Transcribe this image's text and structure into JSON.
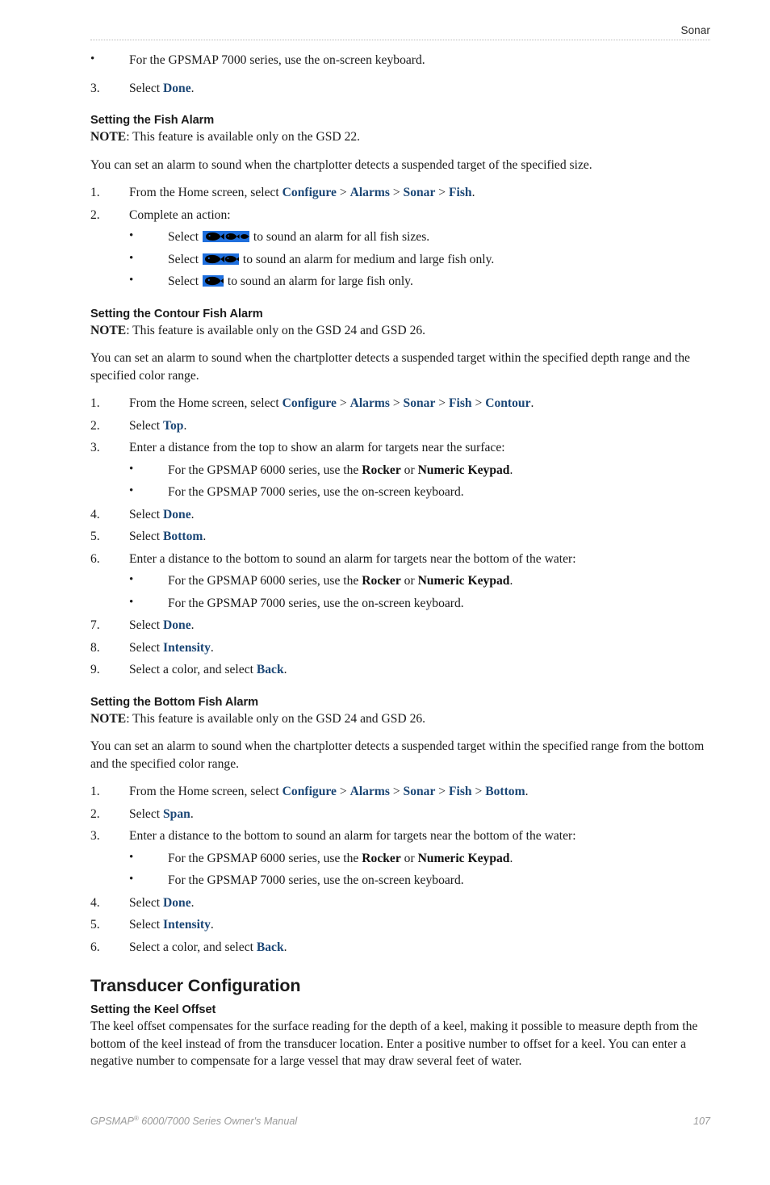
{
  "header": {
    "running_title": "Sonar"
  },
  "footer": {
    "manual_title_pre": "GPSMAP",
    "manual_title_sup": "®",
    "manual_title_post": " 6000/7000 Series Owner's Manual",
    "page_number": "107"
  },
  "colors": {
    "nav_link": "#1c4776",
    "fish_icon_background": "#1f6fdd",
    "fish_body": "#000000",
    "header_rule": "#b9b9b9",
    "footer_text": "#9a9a9a"
  },
  "carryover": {
    "bullet": "For the GPSMAP 7000 series, use the on-screen keyboard.",
    "step3_pre": "Select ",
    "step3_num": "3.",
    "step3_nav": "Done",
    "step3_post": "."
  },
  "sections": [
    {
      "id": "fish-alarm",
      "heading": "Setting the Fish Alarm",
      "note_label": "NOTE",
      "note_text": ": This feature is available only on the GSD 22.",
      "intro": "You can set an alarm to sound when the chartplotter detects a suspended target of the specified size.",
      "step1_num": "1.",
      "step1_pre": "From the Home screen, select ",
      "step1_path": [
        "Configure",
        "Alarms",
        "Sonar",
        "Fish"
      ],
      "step1_post": ".",
      "step2_num": "2.",
      "step2_text": "Complete an action:",
      "icon_bullets": [
        {
          "pre": "Select ",
          "icon": "fish-icon-three",
          "fish_count": 3,
          "post": " to sound an alarm for all fish sizes."
        },
        {
          "pre": "Select ",
          "icon": "fish-icon-two",
          "fish_count": 2,
          "post": " to sound an alarm for medium and large fish only."
        },
        {
          "pre": "Select ",
          "icon": "fish-icon-one",
          "fish_count": 1,
          "post": " to sound an alarm for large fish only."
        }
      ]
    },
    {
      "id": "contour-fish-alarm",
      "heading": "Setting the Contour Fish Alarm",
      "note_label": "NOTE",
      "note_text": ": This feature is available only on the GSD 24 and GSD 26.",
      "intro": "You can set an alarm to sound when the chartplotter detects a suspended target within the specified depth range and the specified color range.",
      "steps": [
        {
          "num": "1.",
          "pre": "From the Home screen, select ",
          "path": [
            "Configure",
            "Alarms",
            "Sonar",
            "Fish",
            "Contour"
          ],
          "post": "."
        },
        {
          "num": "2.",
          "pre": "Select ",
          "nav": "Top",
          "post": "."
        },
        {
          "num": "3.",
          "plain": "Enter a distance from the top to show an alarm for targets near the surface:",
          "bullets": [
            {
              "pre": "For the GPSMAP 6000 series, use the ",
              "b1": "Rocker",
              "mid": " or ",
              "b2": "Numeric Keypad",
              "post": "."
            },
            {
              "plain": "For the GPSMAP 7000 series, use the on-screen keyboard."
            }
          ]
        },
        {
          "num": "4.",
          "pre": "Select ",
          "nav": "Done",
          "post": "."
        },
        {
          "num": "5.",
          "pre": "Select ",
          "nav": "Bottom",
          "post": "."
        },
        {
          "num": "6.",
          "plain": "Enter a distance to the bottom to sound an alarm for targets near the bottom of the water:",
          "bullets": [
            {
              "pre": "For the GPSMAP 6000 series, use the ",
              "b1": "Rocker",
              "mid": " or ",
              "b2": "Numeric Keypad",
              "post": "."
            },
            {
              "plain": "For the GPSMAP 7000 series, use the on-screen keyboard."
            }
          ]
        },
        {
          "num": "7.",
          "pre": "Select ",
          "nav": "Done",
          "post": "."
        },
        {
          "num": "8.",
          "pre": "Select ",
          "nav": "Intensity",
          "post": "."
        },
        {
          "num": "9.",
          "pre": "Select a color, and select ",
          "nav": "Back",
          "post": "."
        }
      ]
    },
    {
      "id": "bottom-fish-alarm",
      "heading": "Setting the Bottom Fish Alarm",
      "note_label": "NOTE",
      "note_text": ": This feature is available only on the GSD 24 and GSD 26.",
      "intro": "You can set an alarm to sound when the chartplotter detects a suspended target within the specified range from the bottom and the specified color range.",
      "steps": [
        {
          "num": "1.",
          "pre": "From the Home screen, select ",
          "path": [
            "Configure",
            "Alarms",
            "Sonar",
            "Fish",
            "Bottom"
          ],
          "post": "."
        },
        {
          "num": "2.",
          "pre": "Select ",
          "nav": "Span",
          "post": "."
        },
        {
          "num": "3.",
          "plain": "Enter a distance to the bottom to sound an alarm for targets near the bottom of the water:",
          "bullets": [
            {
              "pre": "For the GPSMAP 6000 series, use the ",
              "b1": "Rocker",
              "mid": " or ",
              "b2": "Numeric Keypad",
              "post": "."
            },
            {
              "plain": "For the GPSMAP 7000 series, use the on-screen keyboard."
            }
          ]
        },
        {
          "num": "4.",
          "pre": "Select ",
          "nav": "Done",
          "post": "."
        },
        {
          "num": "5.",
          "pre": "Select ",
          "nav": "Intensity",
          "post": "."
        },
        {
          "num": "6.",
          "pre": "Select a color, and select ",
          "nav": "Back",
          "post": "."
        }
      ]
    },
    {
      "id": "transducer-configuration",
      "major_heading": "Transducer Configuration",
      "heading": "Setting the Keel Offset",
      "body": "The keel offset compensates for the surface reading for the depth of a keel, making it possible to measure depth from the bottom of the keel instead of from the transducer location. Enter a positive number to offset for a keel. You can enter a negative number to compensate for a large vessel that may draw several feet of water."
    }
  ]
}
